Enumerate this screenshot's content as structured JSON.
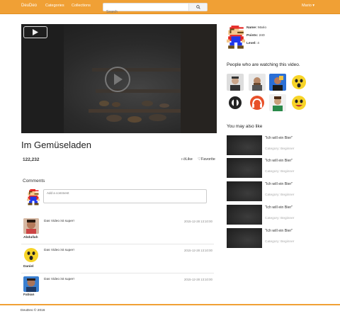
{
  "navbar": {
    "brand": "DeuDeo",
    "categories": "Categories",
    "collections": "Collections",
    "search_placeholder": "Search",
    "user": "Mario ▾"
  },
  "video": {
    "title": "Im Gemüseladen",
    "views": "122,232",
    "like_label": "Like",
    "favorite_label": "Favorite"
  },
  "comments": {
    "heading": "Comments",
    "input_placeholder": "Add a comment",
    "items": [
      {
        "name": "Abdullah",
        "text": "Das Video ist super!",
        "time": "2015-12-28 13:10:00"
      },
      {
        "name": "Daniel",
        "text": "Das Video ist super!",
        "time": "2015-12-28 13:10:00"
      },
      {
        "name": "Fabian",
        "text": "Das Video ist super!",
        "time": "2015-12-28 13:10:00"
      }
    ]
  },
  "profile": {
    "name_label": "Name:",
    "name_value": "Mario",
    "points_label": "Points:",
    "points_value": "240",
    "level_label": "Level:",
    "level_value": "4"
  },
  "watchers": {
    "heading": "People who are watching this video."
  },
  "recommendations": {
    "heading": "You may also like",
    "items": [
      {
        "title": "\"Ich will ein Bier\"",
        "category_label": "Category:",
        "category": "Beginner"
      },
      {
        "title": "\"Ich will ein Bier\"",
        "category_label": "Category:",
        "category": "Beginner"
      },
      {
        "title": "\"Ich will ein Bier\"",
        "category_label": "Category:",
        "category": "Beginner"
      },
      {
        "title": "\"Ich will ein Bier\"",
        "category_label": "Category:",
        "category": "Beginner"
      },
      {
        "title": "\"Ich will ein Bier\"",
        "category_label": "Category:",
        "category": "Beginner"
      }
    ]
  },
  "footer": {
    "text": "DeuDeo © 2016"
  },
  "colors": {
    "accent": "#f0a035",
    "mario_red": "#e52521",
    "mario_blue": "#2038ec"
  }
}
